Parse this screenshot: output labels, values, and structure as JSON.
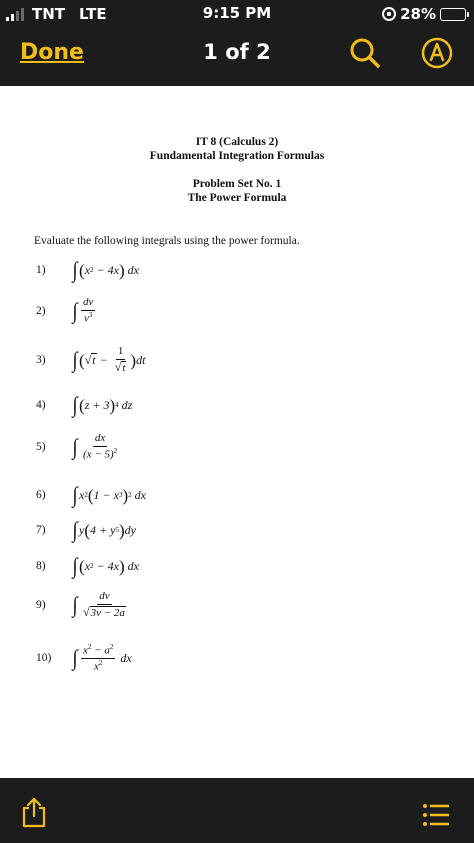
{
  "status_bar": {
    "carrier": "TNT",
    "network": "LTE",
    "time": "9:15 PM",
    "battery": "28%",
    "battery_level": 0.28,
    "icons": [
      "signal-icon",
      "rotation-lock-icon",
      "battery-icon"
    ]
  },
  "toolbar": {
    "done_label": "Done",
    "page_indicator": "1 of 2",
    "accent_color": "#f2bd1b",
    "icons": [
      "search-icon",
      "markup-icon"
    ]
  },
  "document": {
    "course": "IT 8 (Calculus 2)",
    "topic": "Fundamental Integration Formulas",
    "set_title": "Problem Set No. 1",
    "set_subtitle": "The Power Formula",
    "instructions": "Evaluate the following integrals using the power formula.",
    "problems": [
      {
        "num": "1)",
        "dx": "dx"
      },
      {
        "num": "2)",
        "numer": "dv",
        "denom": "v"
      },
      {
        "num": "3)",
        "dt": "dt"
      },
      {
        "num": "4)",
        "dz": "dz"
      },
      {
        "num": "5)",
        "numer": "dx",
        "denom": "(x − 5)"
      },
      {
        "num": "6)",
        "dx": "dx"
      },
      {
        "num": "7)",
        "dy": "dy"
      },
      {
        "num": "8)",
        "dx": "dx"
      },
      {
        "num": "9)",
        "numer": "dv",
        "denom": "3v − 2a"
      },
      {
        "num": "10)",
        "dx": "dx"
      }
    ]
  },
  "bottom_bar": {
    "icons": [
      "share-icon",
      "list-icon"
    ]
  }
}
